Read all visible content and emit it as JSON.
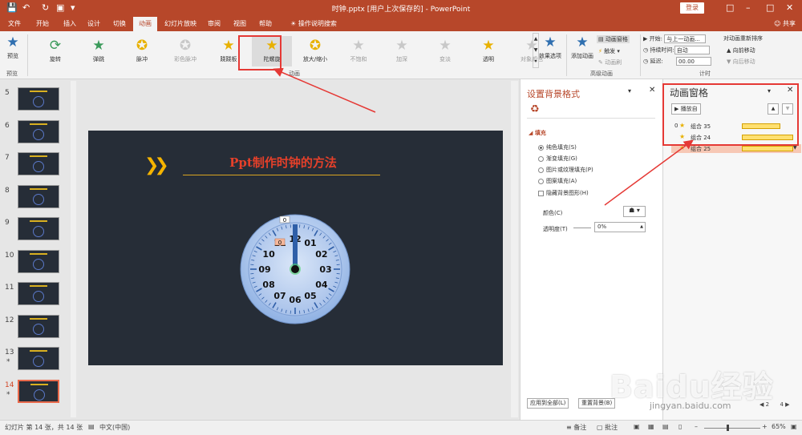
{
  "window": {
    "title": "时钟.pptx [用户上次保存的] - PowerPoint",
    "login": "登录",
    "icons": [
      "save-icon",
      "undo-icon",
      "redo-icon",
      "present-icon",
      "customize-icon"
    ]
  },
  "menu": {
    "tabs": [
      "文件",
      "开始",
      "插入",
      "设计",
      "切换",
      "动画",
      "幻灯片放映",
      "审阅",
      "视图",
      "帮助"
    ],
    "search": "操作说明搜索",
    "share": "共享"
  },
  "ribbon": {
    "preview": {
      "label": "预览",
      "group": "预览"
    },
    "effects": [
      {
        "label": "旋转",
        "gray": false
      },
      {
        "label": "弹跳",
        "gray": false
      },
      {
        "label": "脉冲",
        "gray": false
      },
      {
        "label": "彩色脉冲",
        "gray": true
      },
      {
        "label": "跷跷板",
        "gray": false
      },
      {
        "label": "陀螺旋",
        "gray": false
      },
      {
        "label": "放大/缩小",
        "gray": false
      },
      {
        "label": "不饱和",
        "gray": true
      },
      {
        "label": "加深",
        "gray": true
      },
      {
        "label": "变淡",
        "gray": true
      },
      {
        "label": "透明",
        "gray": false
      },
      {
        "label": "对象颜色",
        "gray": true
      }
    ],
    "effect_options": "效果选项",
    "animation_group": "动画",
    "add_animation": "添加动画",
    "anim_pane_btn": "动画窗格",
    "trigger": "触发",
    "anim_painter": "动画刷",
    "advanced_group": "高级动画",
    "start_label": "开始:",
    "start_value": "与上一动画...",
    "duration_label": "持续时间:",
    "duration_value": "自动",
    "delay_label": "延迟:",
    "delay_value": "00.00",
    "reorder": "对动画重新排序",
    "move_earlier": "向前移动",
    "move_later": "向后移动",
    "timing_group": "计时"
  },
  "thumbnails": [
    {
      "num": "5",
      "star": ""
    },
    {
      "num": "6",
      "star": ""
    },
    {
      "num": "7",
      "star": ""
    },
    {
      "num": "8",
      "star": ""
    },
    {
      "num": "9",
      "star": ""
    },
    {
      "num": "10",
      "star": ""
    },
    {
      "num": "11",
      "star": ""
    },
    {
      "num": "12",
      "star": ""
    },
    {
      "num": "13",
      "star": "*"
    },
    {
      "num": "14",
      "star": "*"
    }
  ],
  "slide": {
    "title": "Ppt制作时钟的方法",
    "clock_numbers": [
      "12",
      "01",
      "02",
      "03",
      "04",
      "05",
      "06",
      "07",
      "08",
      "09",
      "10",
      "11"
    ],
    "label_top": "0",
    "label_mid": "0"
  },
  "format_pane": {
    "title": "设置背景格式",
    "section": "填充",
    "options": [
      "纯色填充(S)",
      "渐变填充(G)",
      "图片或纹理填充(P)",
      "图案填充(A)"
    ],
    "hide_bg": "隐藏背景图形(H)",
    "color_label": "颜色(C)",
    "transparency_label": "透明度(T)",
    "transparency_value": "0%",
    "apply_all": "应用到全部(L)",
    "reset_bg": "重置背景(B)"
  },
  "anim_pane": {
    "title": "动画窗格",
    "play_from": "播放自",
    "rows": [
      {
        "index": "0",
        "label": "组合 35"
      },
      {
        "index": "",
        "label": "组合 24"
      },
      {
        "index": "",
        "label": "组合 25"
      }
    ],
    "page_nav": [
      "2",
      "4"
    ]
  },
  "status": {
    "slide_info": "幻灯片 第 14 张，共 14 张",
    "language": "中文(中国)",
    "notes": "备注",
    "comments": "批注",
    "zoom": "65%"
  },
  "watermark": {
    "text": "Baidu经验",
    "sub": "jingyan.baidu.com"
  },
  "colors": {
    "accent": "#b7472a",
    "slide_bg": "#262d37",
    "highlight": "#e53935"
  }
}
